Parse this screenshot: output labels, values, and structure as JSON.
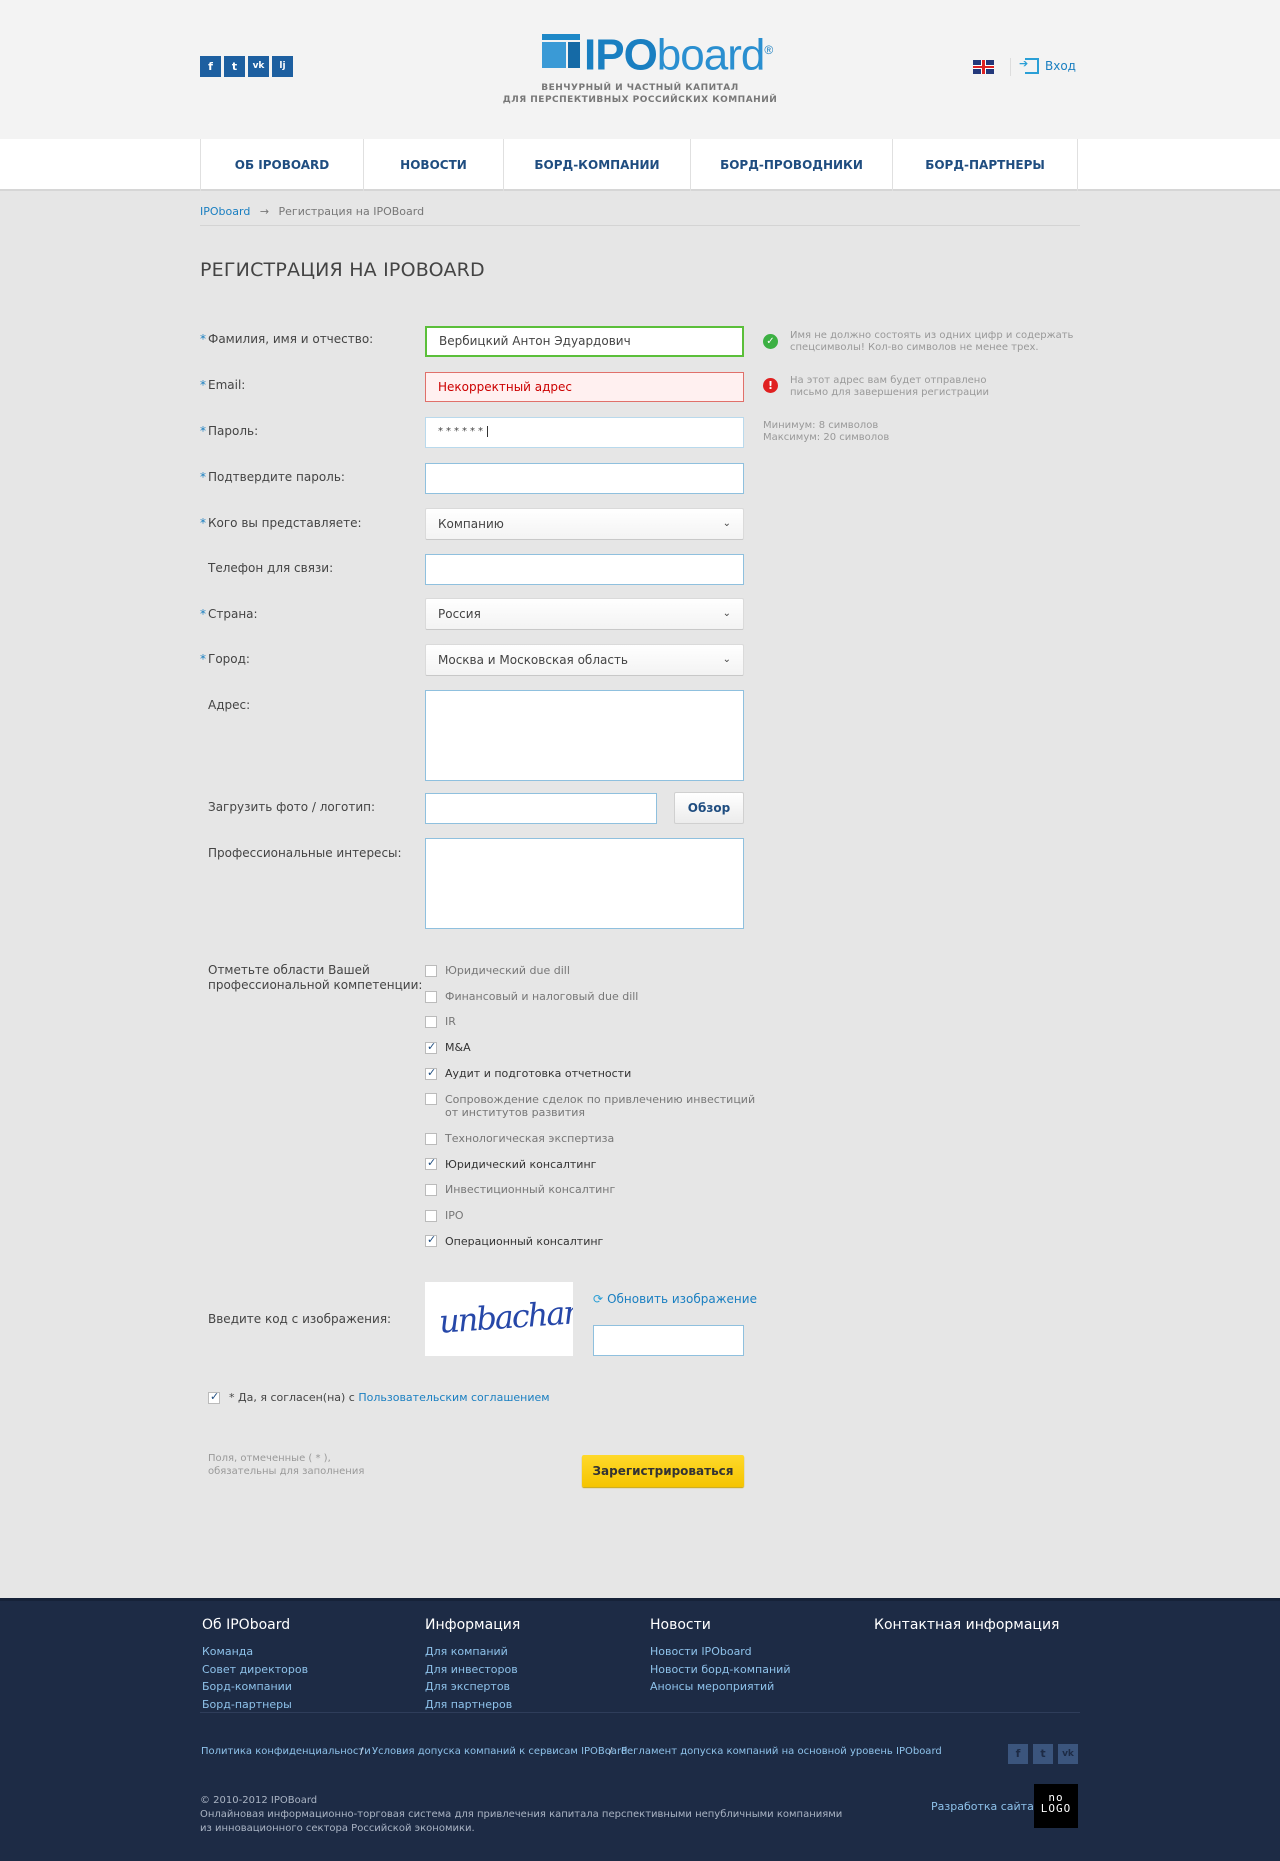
{
  "header": {
    "social": [
      "f",
      "t",
      "vk",
      "lj"
    ],
    "logo_bold": "IPO",
    "logo_light": "board",
    "logo_reg": "®",
    "tagline_1": "ВЕНЧУРНЫЙ И ЧАСТНЫЙ КАПИТАЛ",
    "tagline_2": "ДЛЯ ПЕРСПЕКТИВНЫХ РОССИЙСКИХ КОМПАНИЙ",
    "login": "Вход"
  },
  "nav": [
    "ОБ IPOBOARD",
    "НОВОСТИ",
    "БОРД-КОМПАНИИ",
    "БОРД-ПРОВОДНИКИ",
    "БОРД-ПАРТНЕРЫ"
  ],
  "breadcrumb": {
    "home": "IPOboard",
    "arrow": "→",
    "current": "Регистрация на IPOBoard"
  },
  "page_title": "РЕГИСТРАЦИЯ НА IPOBOARD",
  "form": {
    "star": "*",
    "fio": {
      "label": "Фамилия, имя и отчество:",
      "value": "Вербицкий Антон Эдуардович",
      "hint_1": "Имя не должно состоять из одних цифр и содержать",
      "hint_2": "спецсимволы! Кол-во символов не менее трех."
    },
    "email": {
      "label": "Email:",
      "value": "Некорректный адрес",
      "hint_1": "На этот адрес вам будет отправлено",
      "hint_2": "письмо для завершения регистрации"
    },
    "password": {
      "label": "Пароль:",
      "value": "******",
      "hint_1": "Минимум: 8 символов",
      "hint_2": "Максимум: 20 символов"
    },
    "confirm": {
      "label": "Подтвердите пароль:"
    },
    "represent": {
      "label": "Кого вы представляете:",
      "value": "Компанию"
    },
    "phone": {
      "label": "Телефон для связи:"
    },
    "country": {
      "label": "Страна:",
      "value": "Россия"
    },
    "city": {
      "label": "Город:",
      "value": "Москва и Московская область"
    },
    "address": {
      "label": "Адрес:"
    },
    "photo": {
      "label": "Загрузить фото / логотип:",
      "button": "Обзор"
    },
    "interests": {
      "label": "Профессиональные интересы:"
    },
    "competence": {
      "label_1": "Отметьте области Вашей",
      "label_2": "профессиональной компетенции:",
      "options": [
        {
          "label": "Юридический  due dill",
          "checked": false
        },
        {
          "label": "Финансовый и налоговый due dill",
          "checked": false
        },
        {
          "label": "IR",
          "checked": false
        },
        {
          "label": "M&A",
          "checked": true
        },
        {
          "label": "Аудит и подготовка отчетности",
          "checked": true
        },
        {
          "label": "Сопровождение сделок по привлечению инвестиций",
          "label2": "от институтов развития",
          "checked": false
        },
        {
          "label": "Технологическая экспертиза",
          "checked": false
        },
        {
          "label": "Юридический консалтинг",
          "checked": true
        },
        {
          "label": "Инвестиционный консалтинг",
          "checked": false
        },
        {
          "label": "IPO",
          "checked": false
        },
        {
          "label": "Операционный консалтинг",
          "checked": true
        }
      ]
    },
    "captcha": {
      "label": "Введите код с изображения:",
      "text": "unbachar",
      "refresh": "Обновить изображение"
    },
    "agree": {
      "prefix": "* Да, я согласен(на) с ",
      "link": "Пользовательским соглашением"
    },
    "required_note_1": "Поля, отмеченные ( * ),",
    "required_note_2": "обязательны для заполнения",
    "submit": "Зарегистрироваться"
  },
  "footer": {
    "columns": [
      {
        "title": "Об IPOboard",
        "links": [
          "Команда",
          "Совет директоров",
          "Борд-компании",
          "Борд-партнеры"
        ]
      },
      {
        "title": "Информация",
        "links": [
          "Для компаний",
          "Для инвесторов",
          "Для экспертов",
          "Для партнеров"
        ]
      },
      {
        "title": "Новости",
        "links": [
          "Новости IPOboard",
          "Новости борд-компаний",
          "Анонсы мероприятий"
        ]
      },
      {
        "title": "Контактная информация",
        "links": []
      }
    ],
    "legal": [
      "Политика конфиденциальности",
      "Условия допуска компаний к сервисам IPOBoard",
      "Регламент допуска компаний на основной уровень IPOboard"
    ],
    "legal_sep": "/",
    "social": [
      "f",
      "t",
      "vk"
    ],
    "copyright_1": "© 2010-2012 IPOBoard",
    "copyright_2": "Онлайновая информационно-торговая система для привлечения капитала перспективными непубличными компаниями",
    "copyright_3": "из инновационного сектора Российской экономики.",
    "developer": "Разработка сайта",
    "nologo_1": "no",
    "nologo_2": "LOGO"
  },
  "colors": {
    "accent": "#1a7fc1",
    "footer_bg": "#1d2b45",
    "submit": "#ffd92a",
    "ok": "#3cb043",
    "error": "#e02020"
  }
}
